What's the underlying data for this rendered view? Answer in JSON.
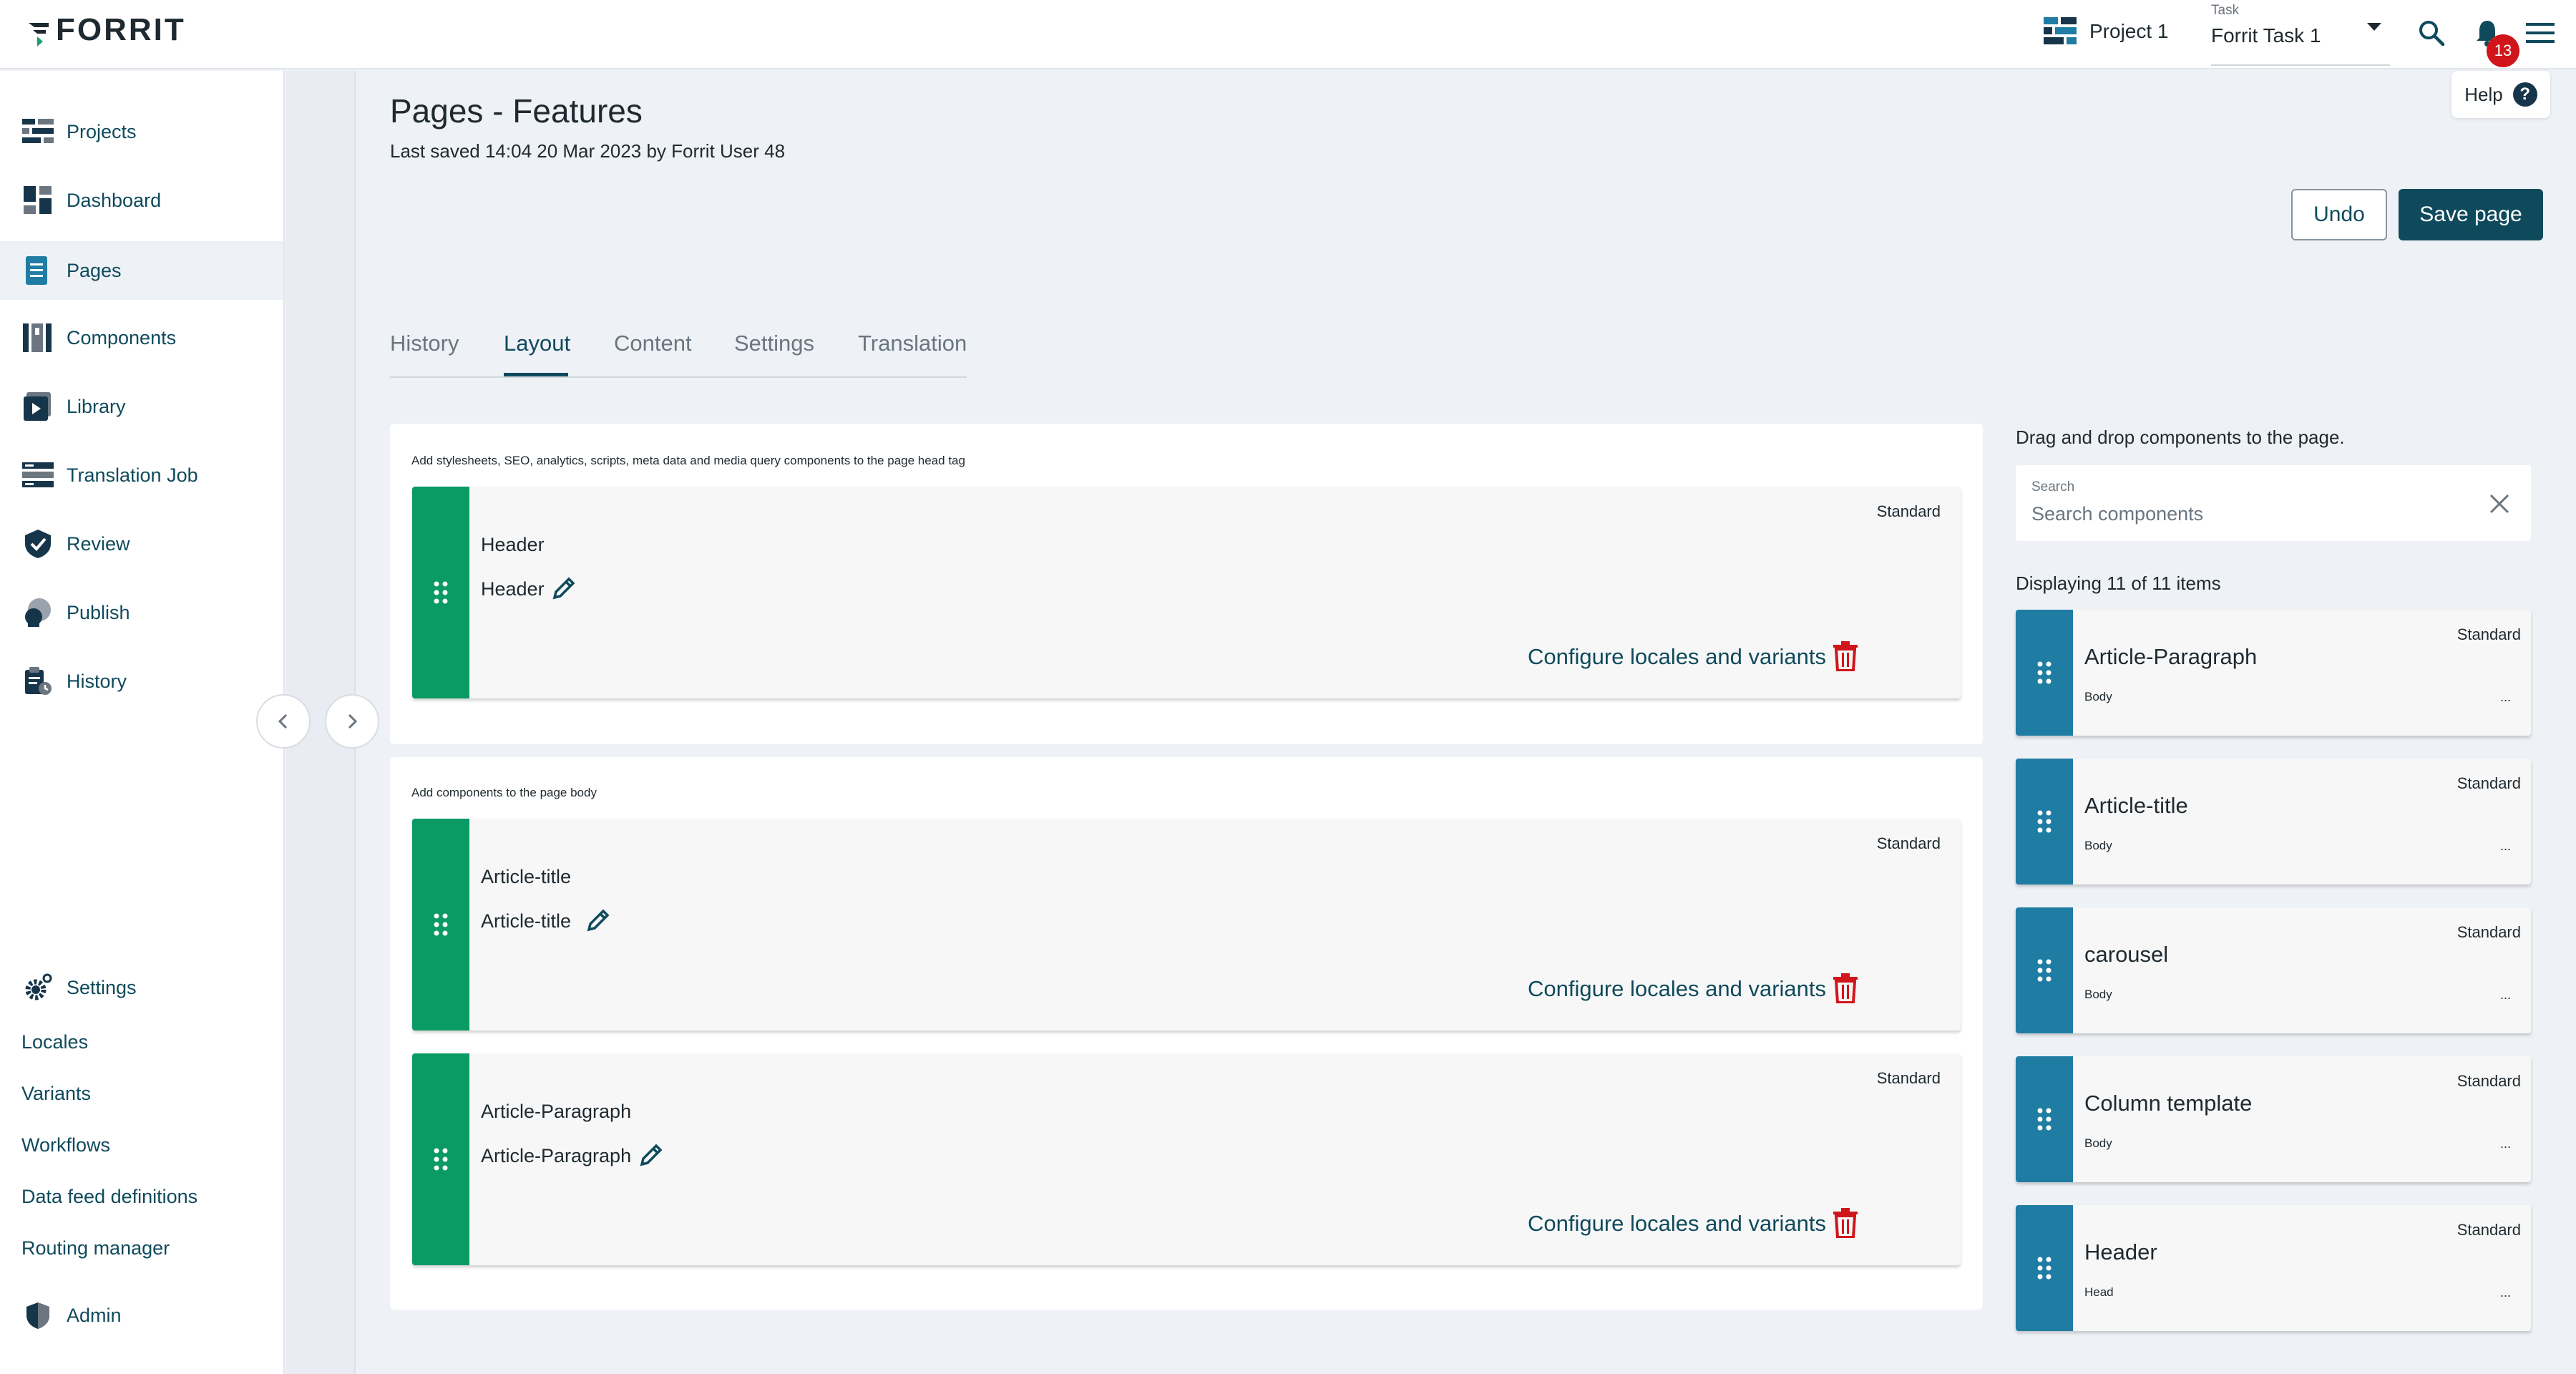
{
  "app": {
    "logo_text": "FORRIT",
    "project": "Project 1",
    "task_caption": "Task",
    "task_value": "Forrit Task 1",
    "notification_count": "13",
    "help_label": "Help"
  },
  "sidebar": {
    "items": [
      {
        "label": "Projects",
        "icon": "projects-icon"
      },
      {
        "label": "Dashboard",
        "icon": "dashboard-icon"
      },
      {
        "label": "Pages",
        "icon": "pages-icon",
        "active": true
      },
      {
        "label": "Components",
        "icon": "components-icon"
      },
      {
        "label": "Library",
        "icon": "library-icon"
      },
      {
        "label": "Translation Job",
        "icon": "translation-job-icon"
      },
      {
        "label": "Review",
        "icon": "review-icon"
      },
      {
        "label": "Publish",
        "icon": "publish-icon"
      },
      {
        "label": "History",
        "icon": "history-icon"
      }
    ],
    "settings": {
      "label": "Settings",
      "sub_items": [
        "Locales",
        "Variants",
        "Workflows",
        "Data feed definitions",
        "Routing manager"
      ]
    },
    "admin_label": "Admin"
  },
  "page": {
    "title": "Pages - Features",
    "subtitle": "Last saved 14:04 20 Mar 2023 by Forrit User 48",
    "undo_label": "Undo",
    "save_label": "Save page"
  },
  "tabs": [
    {
      "label": "History"
    },
    {
      "label": "Layout",
      "active": true
    },
    {
      "label": "Content"
    },
    {
      "label": "Settings"
    },
    {
      "label": "Translation"
    }
  ],
  "head_section": {
    "caption": "Add stylesheets, SEO, analytics, scripts, meta data and media query components to the page head tag",
    "components": [
      {
        "title": "Header",
        "name": "Header",
        "tag": "Standard",
        "config_label": "Configure locales and variants"
      }
    ]
  },
  "body_section": {
    "caption": "Add components to the page body",
    "components": [
      {
        "title": "Article-title",
        "name": "Article-title",
        "tag": "Standard",
        "config_label": "Configure locales and variants"
      },
      {
        "title": "Article-Paragraph",
        "name": "Article-Paragraph",
        "tag": "Standard",
        "config_label": "Configure locales and variants"
      }
    ]
  },
  "library_panel": {
    "title": "Drag and drop components to the page.",
    "search_caption": "Search",
    "search_placeholder": "Search components",
    "count_text": "Displaying 11 of 11 items",
    "items": [
      {
        "name": "Article-Paragraph",
        "type": "Body",
        "tag": "Standard",
        "more": "..."
      },
      {
        "name": "Article-title",
        "type": "Body",
        "tag": "Standard",
        "more": "..."
      },
      {
        "name": "carousel",
        "type": "Body",
        "tag": "Standard",
        "more": "..."
      },
      {
        "name": "Column template",
        "type": "Body",
        "tag": "Standard",
        "more": "..."
      },
      {
        "name": "Header",
        "type": "Head",
        "tag": "Standard",
        "more": "..."
      }
    ]
  },
  "colors": {
    "primary": "#0f4a5c",
    "page_component_strip": "#0a9a63",
    "library_component_strip": "#1f7da3",
    "delete": "#d0161b",
    "badge": "#d0161b"
  }
}
